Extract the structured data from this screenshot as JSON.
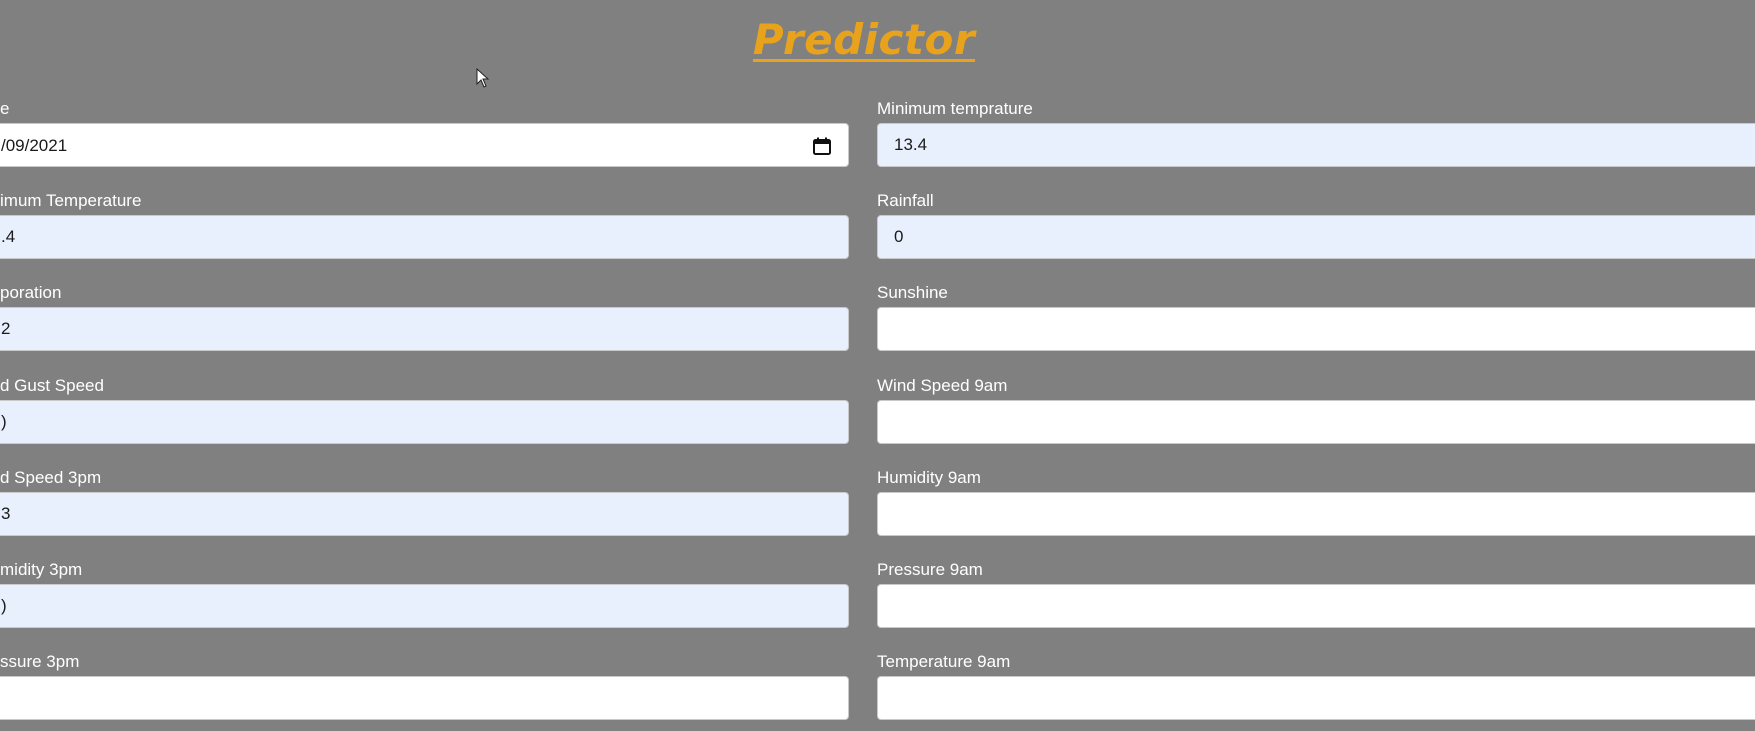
{
  "page": {
    "title": "Predictor"
  },
  "colors": {
    "background": "#808080",
    "title": "#e8a21c",
    "input_filled": "#e8f0fe",
    "input_empty": "#ffffff",
    "label": "#ffffff"
  },
  "left_column": {
    "date": {
      "label": "e",
      "value": "/09/2021",
      "icon": "calendar-icon"
    },
    "maximum_temperature": {
      "label": "imum Temperature",
      "value": ".4"
    },
    "evaporation": {
      "label": "poration",
      "value": "2"
    },
    "wind_gust_speed": {
      "label": "d Gust Speed",
      "value": ")"
    },
    "wind_speed_3pm": {
      "label": "d Speed 3pm",
      "value": "3"
    },
    "humidity_3pm": {
      "label": "midity 3pm",
      "value": ")"
    },
    "pressure_3pm": {
      "label": "ssure 3pm",
      "value": ""
    }
  },
  "right_column": {
    "minimum_temperature": {
      "label": "Minimum temprature",
      "value": "13.4"
    },
    "rainfall": {
      "label": "Rainfall",
      "value": "0"
    },
    "sunshine": {
      "label": "Sunshine",
      "value": ""
    },
    "wind_speed_9am": {
      "label": "Wind Speed 9am",
      "value": ""
    },
    "humidity_9am": {
      "label": "Humidity 9am",
      "value": ""
    },
    "pressure_9am": {
      "label": "Pressure 9am",
      "value": ""
    },
    "temperature_9am": {
      "label": "Temperature 9am",
      "value": ""
    }
  }
}
